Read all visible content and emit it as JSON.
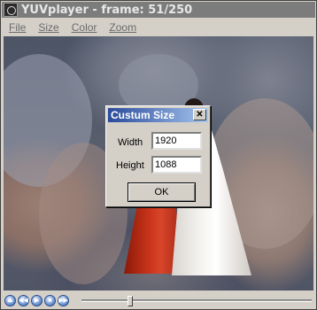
{
  "window": {
    "title": "YUVplayer - frame: 51/250",
    "app_icon": "film-reel-icon"
  },
  "menubar": {
    "items": [
      {
        "label": "File"
      },
      {
        "label": "Size"
      },
      {
        "label": "Color"
      },
      {
        "label": "Zoom"
      }
    ]
  },
  "dialog": {
    "title": "Custum Size",
    "close_icon": "close-icon",
    "width_label": "Width",
    "width_value": "1920",
    "height_label": "Height",
    "height_value": "1088",
    "ok_label": "OK"
  },
  "controls": {
    "buttons": [
      {
        "icon": "eject-icon"
      },
      {
        "icon": "rewind-icon"
      },
      {
        "icon": "play-icon"
      },
      {
        "icon": "stop-icon"
      },
      {
        "icon": "fast-forward-icon"
      }
    ],
    "seek_fraction": 0.204
  },
  "colors": {
    "titlebar": "#7c7c7c",
    "dialog_title_start": "#2a4a9c",
    "dialog_title_end": "#a6c6ee",
    "control_blue": "#5b86c9"
  }
}
